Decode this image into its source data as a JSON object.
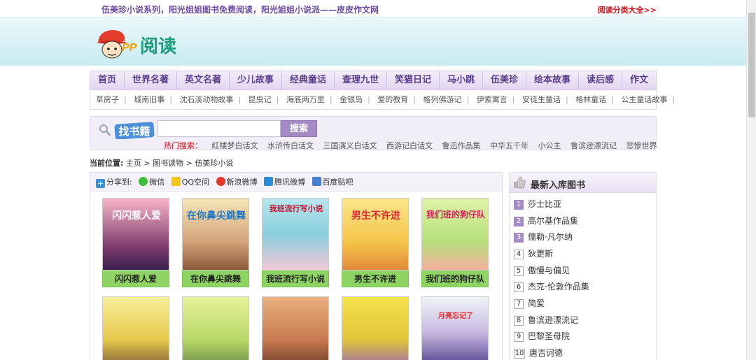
{
  "topbar": {
    "slogan": "伍美珍小说系列，阳光姐姐图书免费阅读，阳光姐姐小说派——皮皮作文网",
    "category_link": "阅读分类大全>>"
  },
  "header": {
    "logo_text": "阅读"
  },
  "nav": {
    "items": [
      "首页",
      "世界名著",
      "英文名著",
      "少儿故事",
      "经典童话",
      "查理九世",
      "笑猫日记",
      "马小跳",
      "伍美珍",
      "绘本故事",
      "读后感",
      "作文"
    ]
  },
  "subnav": {
    "items": [
      "草房子",
      "城南旧事",
      "沈石溪动物故事",
      "昆虫记",
      "海底两万里",
      "金银岛",
      "爱的教育",
      "格列佛游记",
      "伊索寓言",
      "安徒生童话",
      "格林童话",
      "公主童话故事"
    ]
  },
  "search": {
    "title": "找书籍",
    "button": "搜索",
    "hot_label": "热门搜索：",
    "hot_words": [
      "红楼梦白话文",
      "水浒传白话文",
      "三国演义白话文",
      "西游记白话文",
      "鲁迅作品集",
      "中华五千年",
      "小公主",
      "鲁滨逊漂流记",
      "悲惨世界"
    ]
  },
  "breadcrumb": {
    "label": "当前位置:",
    "path": "主页 > 图书读物 > 伍美珍小说"
  },
  "share": {
    "label": "分享到:",
    "targets": [
      "微信",
      "QQ空间",
      "新浪微博",
      "腾讯微博",
      "百度贴吧"
    ]
  },
  "books": [
    {
      "title": "闪闪惹人爱",
      "cover_text": "闪闪惹人爱"
    },
    {
      "title": "在你鼻尖跳舞",
      "cover_text": "在你鼻尖跳舞"
    },
    {
      "title": "我班流行写小说",
      "cover_text": "我班流行写小说"
    },
    {
      "title": "男生不许进",
      "cover_text": "男生不许进"
    },
    {
      "title": "我们班的狗仔队",
      "cover_text": "我们班的狗仔队"
    },
    {
      "title": "",
      "cover_text": ""
    },
    {
      "title": "",
      "cover_text": ""
    },
    {
      "title": "",
      "cover_text": ""
    },
    {
      "title": "",
      "cover_text": ""
    },
    {
      "title": "",
      "cover_text": "月亮忘记了"
    }
  ],
  "sidebar": {
    "title": "最新入库图书",
    "items": [
      {
        "rank": "1",
        "title": "莎士比亚"
      },
      {
        "rank": "2",
        "title": "高尔基作品集"
      },
      {
        "rank": "3",
        "title": "儒勒·凡尔纳"
      },
      {
        "rank": "4",
        "title": "狄更斯"
      },
      {
        "rank": "5",
        "title": "傲慢与偏见"
      },
      {
        "rank": "6",
        "title": "杰克·伦敦作品集"
      },
      {
        "rank": "7",
        "title": "简爱"
      },
      {
        "rank": "8",
        "title": "鲁滨逊漂流记"
      },
      {
        "rank": "9",
        "title": "巴黎圣母院"
      },
      {
        "rank": "10",
        "title": "唐吉诃德"
      }
    ]
  },
  "colors": {
    "accent": "#5a3e8c",
    "button": "#a48bc6",
    "caption": "#8ed463",
    "hot": "#d0101a"
  }
}
